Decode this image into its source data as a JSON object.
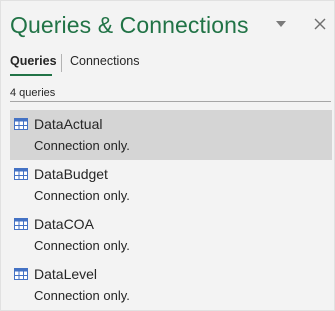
{
  "pane": {
    "title": "Queries & Connections",
    "menu_icon": "chevron-down-icon",
    "close_icon": "close-icon"
  },
  "tabs": [
    {
      "label": "Queries",
      "active": true
    },
    {
      "label": "Connections",
      "active": false
    }
  ],
  "query_count": "4 queries",
  "queries": [
    {
      "name": "DataActual",
      "status": "Connection only.",
      "selected": true,
      "icon": "table-icon"
    },
    {
      "name": "DataBudget",
      "status": "Connection only.",
      "selected": false,
      "icon": "table-icon"
    },
    {
      "name": "DataCOA",
      "status": "Connection only.",
      "selected": false,
      "icon": "table-icon"
    },
    {
      "name": "DataLevel",
      "status": "Connection only.",
      "selected": false,
      "icon": "table-icon"
    }
  ],
  "colors": {
    "accent": "#217346",
    "selected_bg": "#d5d5d5",
    "pane_bg": "#f3f3f3",
    "icon_blue": "#4472c4"
  }
}
